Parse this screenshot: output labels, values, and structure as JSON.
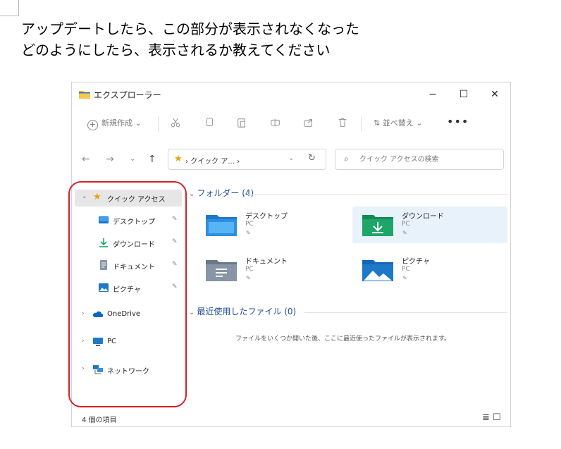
{
  "question": {
    "line1": "アップデートしたら、この部分が表示されなくなった",
    "line2": "どのようにしたら、表示されるか教えてください"
  },
  "window": {
    "title": "エクスプローラー",
    "controls": {
      "minimize": "−",
      "maximize": "☐",
      "close": "✕"
    }
  },
  "toolbar": {
    "new_label": "新規作成",
    "new_chevron": "⌄",
    "cut_icon": "scissors-icon",
    "copy_icon": "copy-icon",
    "paste_icon": "paste-icon",
    "rename_icon": "rename-icon",
    "share_icon": "share-icon",
    "delete_icon": "trash-icon",
    "sort_label": "並べ替え",
    "sort_chevron": "⌄",
    "more": "•••"
  },
  "address": {
    "back": "←",
    "forward": "→",
    "recent": "⌄",
    "up": "↑",
    "path": "› クイック ア... ›",
    "dropdown": "⌄",
    "refresh": "↻",
    "search_placeholder": "クイック アクセスの検索"
  },
  "sidebar": {
    "quick_access": {
      "label": "クイック アクセス",
      "chevron": "⌄"
    },
    "pinned": [
      {
        "label": "デスクトップ",
        "icon": "desktop-icon"
      },
      {
        "label": "ダウンロード",
        "icon": "download-icon"
      },
      {
        "label": "ドキュメント",
        "icon": "documents-icon"
      },
      {
        "label": "ピクチャ",
        "icon": "pictures-icon"
      }
    ],
    "pin_glyph": "📌",
    "roots": [
      {
        "label": "OneDrive",
        "icon": "onedrive-icon",
        "chevron": "›"
      },
      {
        "label": "PC",
        "icon": "pc-icon",
        "chevron": "›"
      },
      {
        "label": "ネットワーク",
        "icon": "network-icon",
        "chevron": "›"
      }
    ]
  },
  "main": {
    "folders_header": "フォルダー (4)",
    "folders_chevron": "⌄",
    "folders": [
      {
        "name": "デスクトップ",
        "location": "PC",
        "color": "#1e78c8"
      },
      {
        "name": "ダウンロード",
        "location": "PC",
        "color": "#1ea66a"
      },
      {
        "name": "ドキュメント",
        "location": "PC",
        "color": "#7d8a9a"
      },
      {
        "name": "ピクチャ",
        "location": "PC",
        "color": "#1e78c8"
      }
    ],
    "recent_header": "最近使用したファイル (0)",
    "recent_chevron": "⌄",
    "recent_empty": "ファイルをいくつか開いた後、ここに最近使ったファイルが表示されます。"
  },
  "status": {
    "count": "4 個の項目",
    "details_view": "≣",
    "tiles_view": "☐"
  },
  "colors": {
    "highlight": "#d51f26",
    "accent": "#1f4e96",
    "folder_yellow": "#f2b21b",
    "selected_tile": "#e8f2fb"
  }
}
